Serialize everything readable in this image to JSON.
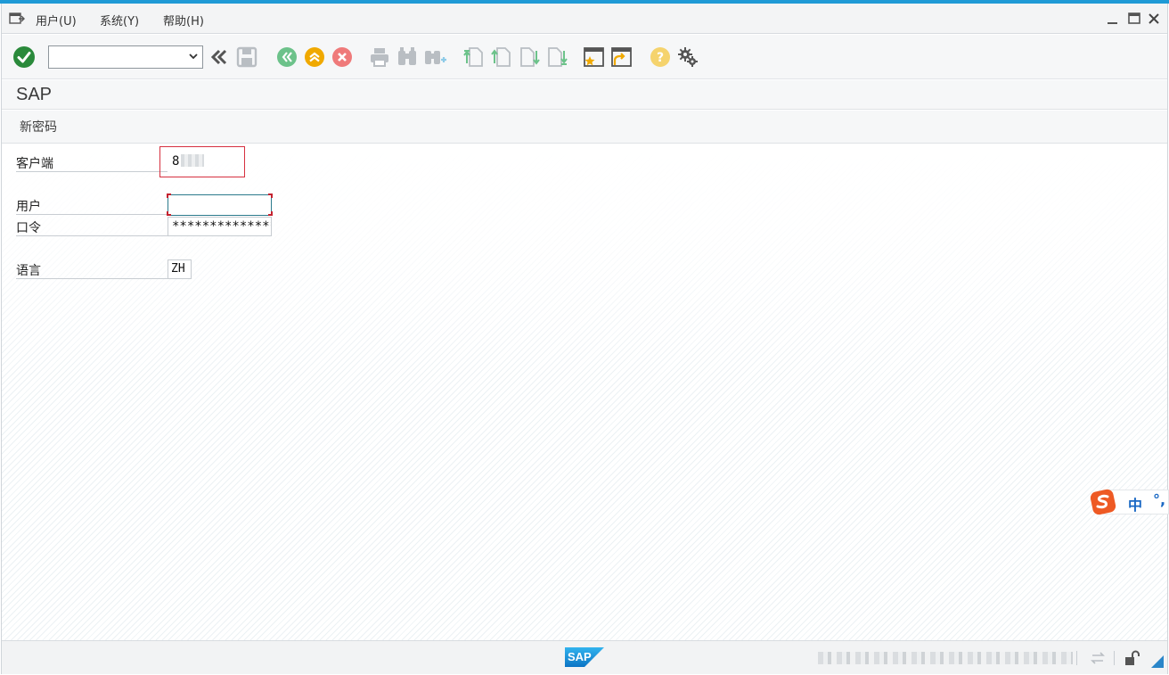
{
  "menubar": {
    "menu_icon": "menu-icon",
    "items": [
      {
        "label": "用户(U)"
      },
      {
        "label": "系统(Y)"
      },
      {
        "label": "帮助(H)"
      }
    ],
    "window_controls": [
      "minimize-icon",
      "maximize-icon",
      "close-icon"
    ]
  },
  "toolbar": {
    "command_field": {
      "value": "",
      "placeholder": ""
    },
    "buttons": [
      "enter-icon",
      "fast-back-icon",
      "save-icon",
      "back-icon",
      "exit-icon",
      "cancel-icon",
      "print-icon",
      "find-icon",
      "find-next-icon",
      "first-page-icon",
      "previous-page-icon",
      "next-page-icon",
      "last-page-icon",
      "new-session-icon",
      "create-shortcut-icon",
      "help-icon",
      "customize-layout-icon"
    ]
  },
  "title": "SAP",
  "app_toolbar": {
    "new_password_label": "新密码"
  },
  "login": {
    "client_label": "客户端",
    "client_value": "8",
    "user_label": "用户",
    "user_value": "",
    "password_label": "口令",
    "password_value": "**************",
    "language_label": "语言",
    "language_value": "ZH"
  },
  "ime": {
    "mode": "中",
    "punct": "°,"
  },
  "statusbar": {
    "logo": "SAP",
    "status_icons": [
      "connection-icon",
      "lock-icon",
      "resize-grip-icon"
    ]
  },
  "colors": {
    "accent_top": "#1f9ad6",
    "enter_green": "#2a8a3b",
    "back_green": "#6cc28a",
    "exit_orange": "#f0a900",
    "cancel_red": "#ef7a7a",
    "sap_blue": "#1a8fd6",
    "error_red": "#d6303f"
  }
}
